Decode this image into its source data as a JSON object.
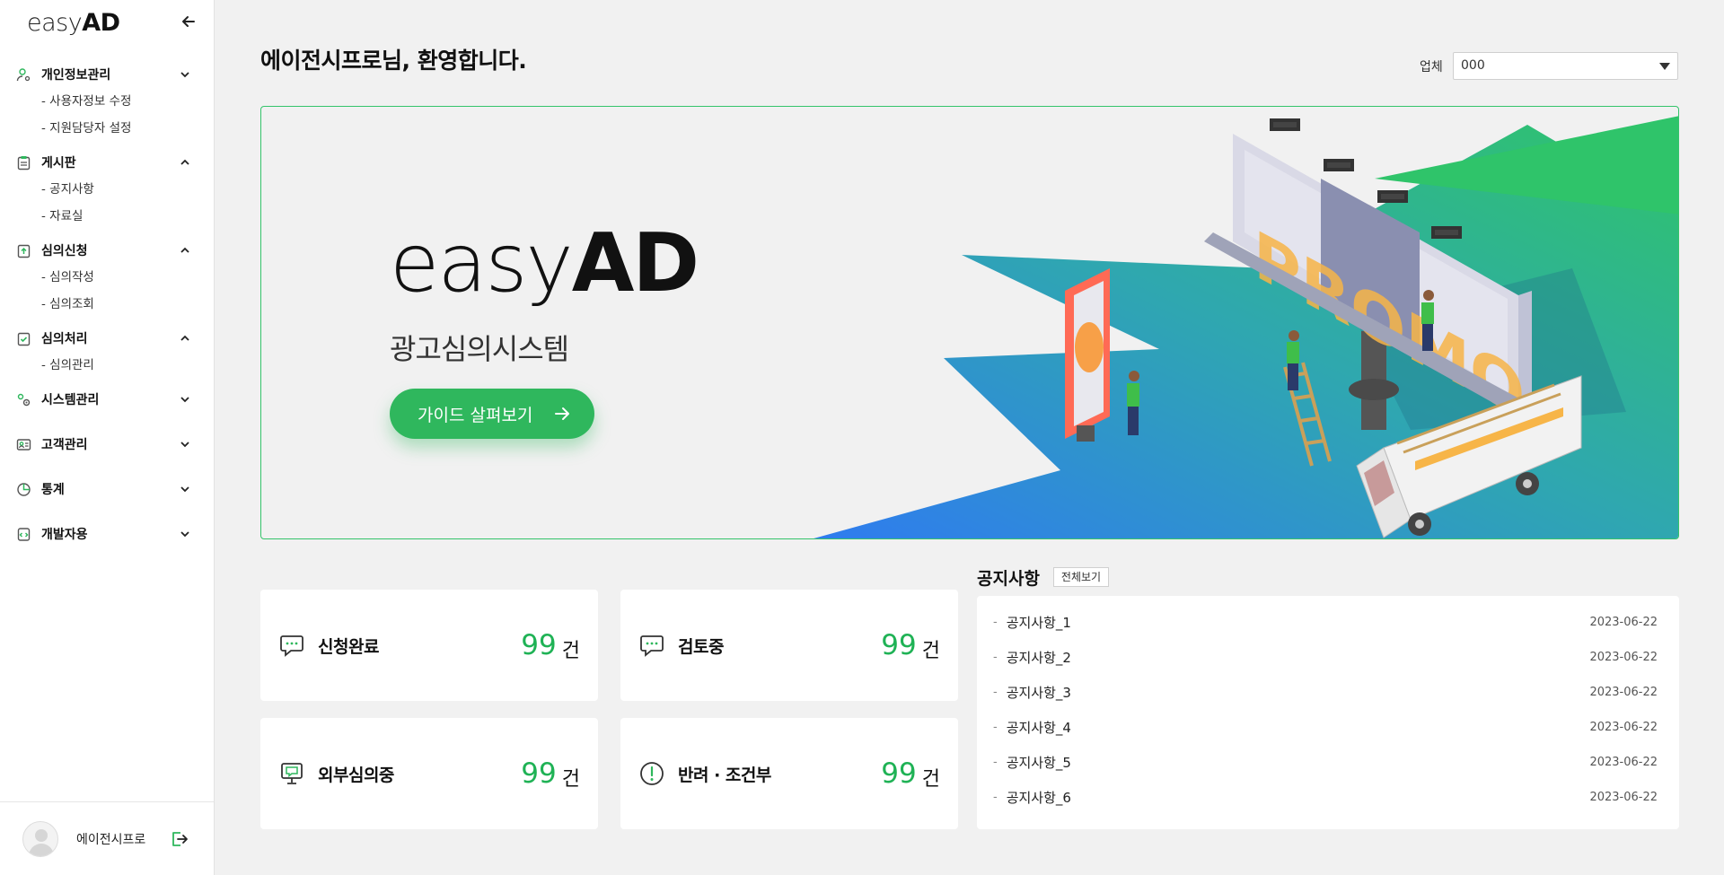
{
  "app": {
    "logo_light": "easy",
    "logo_bold": "AD"
  },
  "sidebar": {
    "groups": [
      {
        "label": "개인정보관리",
        "icon": "user-settings-icon",
        "expanded": true,
        "items": [
          {
            "label": "사용자정보 수정"
          },
          {
            "label": "지원담당자 설정"
          }
        ]
      },
      {
        "label": "게시판",
        "icon": "clipboard-icon",
        "expanded": true,
        "items": [
          {
            "label": "공지사항"
          },
          {
            "label": "자료실"
          }
        ]
      },
      {
        "label": "심의신청",
        "icon": "clipboard-upload-icon",
        "expanded": true,
        "items": [
          {
            "label": "심의작성"
          },
          {
            "label": "심의조회"
          }
        ]
      },
      {
        "label": "심의처리",
        "icon": "clipboard-check-icon",
        "expanded": true,
        "items": [
          {
            "label": "심의관리"
          }
        ]
      },
      {
        "label": "시스템관리",
        "icon": "system-gear-icon",
        "expanded": false,
        "items": []
      },
      {
        "label": "고객관리",
        "icon": "id-card-icon",
        "expanded": false,
        "items": []
      },
      {
        "label": "통계",
        "icon": "pie-chart-icon",
        "expanded": false,
        "items": []
      },
      {
        "label": "개발자용",
        "icon": "developer-icon",
        "expanded": false,
        "items": []
      }
    ],
    "user_name": "에이전시프로"
  },
  "header": {
    "welcome": "에이전시프로님, 환영합니다.",
    "company_label": "업체",
    "company_value": "000"
  },
  "hero": {
    "logo_light": "easy",
    "logo_bold": "AD",
    "subtitle": "광고심의시스템",
    "button_label": "가이드 살펴보기",
    "billboard_text": "PROMO"
  },
  "stats": [
    {
      "label": "신청완료",
      "value": "99",
      "unit": "건",
      "icon": "chat-bubble-icon"
    },
    {
      "label": "검토중",
      "value": "99",
      "unit": "건",
      "icon": "chat-bubble-icon"
    },
    {
      "label": "외부심의중",
      "value": "99",
      "unit": "건",
      "icon": "monitor-chat-icon"
    },
    {
      "label": "반려 · 조건부",
      "value": "99",
      "unit": "건",
      "icon": "exclamation-circle-icon"
    }
  ],
  "notices": {
    "title": "공지사항",
    "view_all": "전체보기",
    "items": [
      {
        "title": "공지사항_1",
        "date": "2023-06-22"
      },
      {
        "title": "공지사항_2",
        "date": "2023-06-22"
      },
      {
        "title": "공지사항_3",
        "date": "2023-06-22"
      },
      {
        "title": "공지사항_4",
        "date": "2023-06-22"
      },
      {
        "title": "공지사항_5",
        "date": "2023-06-22"
      },
      {
        "title": "공지사항_6",
        "date": "2023-06-22"
      }
    ]
  },
  "colors": {
    "accent": "#2fb75d",
    "number": "#1fb255",
    "hero_border": "#35c46b"
  }
}
